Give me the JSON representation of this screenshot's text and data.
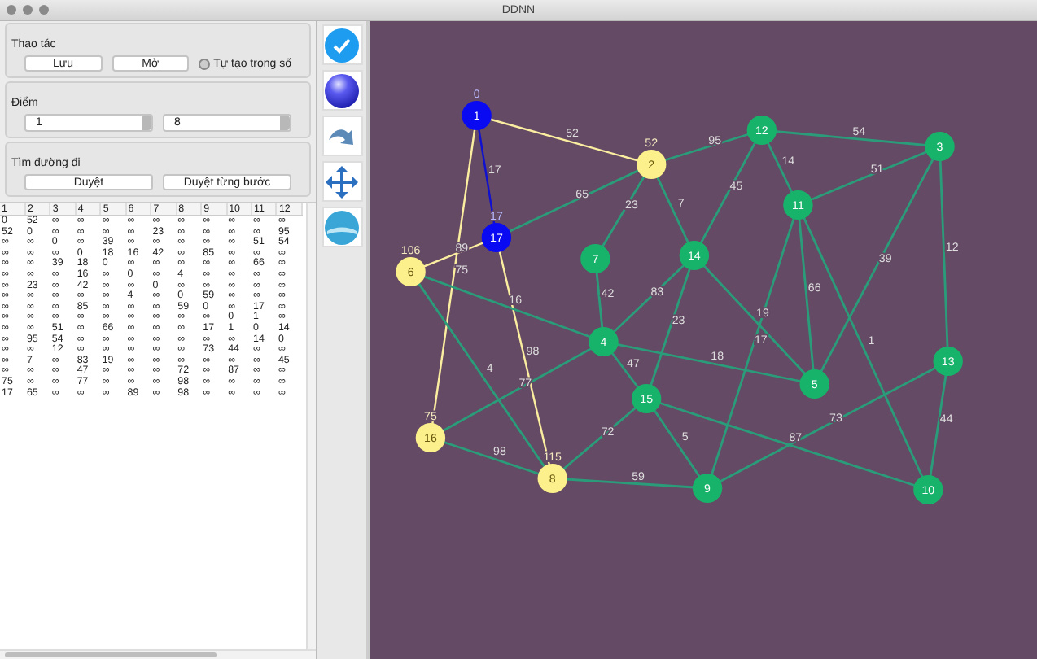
{
  "window": {
    "title": "DDNN"
  },
  "operations": {
    "title": "Thao tác",
    "buttons": [
      "Lưu",
      "Mở"
    ],
    "radio": {
      "label": "Tự tạo trọng số",
      "checked": false
    }
  },
  "points": {
    "title": "Điểm",
    "from": "1",
    "to": "8"
  },
  "search": {
    "title": "Tìm đường đi",
    "buttons": [
      "Duyệt",
      "Duyệt từng bước"
    ]
  },
  "matrix": {
    "columns": [
      "1",
      "2",
      "3",
      "4",
      "5",
      "6",
      "7",
      "8",
      "9",
      "10",
      "11",
      "12"
    ],
    "rows": [
      [
        "0",
        "52",
        "∞",
        "∞",
        "∞",
        "∞",
        "∞",
        "∞",
        "∞",
        "∞",
        "∞",
        "∞"
      ],
      [
        "52",
        "0",
        "∞",
        "∞",
        "∞",
        "∞",
        "23",
        "∞",
        "∞",
        "∞",
        "∞",
        "95"
      ],
      [
        "∞",
        "∞",
        "0",
        "∞",
        "39",
        "∞",
        "∞",
        "∞",
        "∞",
        "∞",
        "51",
        "54"
      ],
      [
        "∞",
        "∞",
        "∞",
        "0",
        "18",
        "16",
        "42",
        "∞",
        "85",
        "∞",
        "∞",
        "∞"
      ],
      [
        "∞",
        "∞",
        "39",
        "18",
        "0",
        "∞",
        "∞",
        "∞",
        "∞",
        "∞",
        "66",
        "∞"
      ],
      [
        "∞",
        "∞",
        "∞",
        "16",
        "∞",
        "0",
        "∞",
        "4",
        "∞",
        "∞",
        "∞",
        "∞"
      ],
      [
        "∞",
        "23",
        "∞",
        "42",
        "∞",
        "∞",
        "0",
        "∞",
        "∞",
        "∞",
        "∞",
        "∞"
      ],
      [
        "∞",
        "∞",
        "∞",
        "∞",
        "∞",
        "4",
        "∞",
        "0",
        "59",
        "∞",
        "∞",
        "∞"
      ],
      [
        "∞",
        "∞",
        "∞",
        "85",
        "∞",
        "∞",
        "∞",
        "59",
        "0",
        "∞",
        "17",
        "∞"
      ],
      [
        "∞",
        "∞",
        "∞",
        "∞",
        "∞",
        "∞",
        "∞",
        "∞",
        "∞",
        "0",
        "1",
        "∞"
      ],
      [
        "∞",
        "∞",
        "51",
        "∞",
        "66",
        "∞",
        "∞",
        "∞",
        "17",
        "1",
        "0",
        "14"
      ],
      [
        "∞",
        "95",
        "54",
        "∞",
        "∞",
        "∞",
        "∞",
        "∞",
        "∞",
        "∞",
        "14",
        "0"
      ],
      [
        "∞",
        "∞",
        "12",
        "∞",
        "∞",
        "∞",
        "∞",
        "∞",
        "73",
        "44",
        "∞",
        "∞"
      ],
      [
        "∞",
        "7",
        "∞",
        "83",
        "19",
        "∞",
        "∞",
        "∞",
        "∞",
        "∞",
        "∞",
        "45"
      ],
      [
        "∞",
        "∞",
        "∞",
        "47",
        "∞",
        "∞",
        "∞",
        "72",
        "∞",
        "87",
        "∞",
        "∞"
      ],
      [
        "75",
        "∞",
        "∞",
        "77",
        "∞",
        "∞",
        "∞",
        "98",
        "∞",
        "∞",
        "∞",
        "∞"
      ],
      [
        "17",
        "65",
        "∞",
        "∞",
        "∞",
        "89",
        "∞",
        "98",
        "∞",
        "∞",
        "∞",
        "∞"
      ]
    ]
  },
  "graph": {
    "nodes": [
      {
        "label": "1",
        "kind": "path",
        "distance": "0"
      },
      {
        "label": "2",
        "kind": "visited",
        "distance": "52"
      },
      {
        "label": "3",
        "kind": "normal"
      },
      {
        "label": "4",
        "kind": "normal"
      },
      {
        "label": "5",
        "kind": "normal"
      },
      {
        "label": "6",
        "kind": "visited",
        "distance": "106"
      },
      {
        "label": "7",
        "kind": "normal"
      },
      {
        "label": "8",
        "kind": "visited",
        "distance": "115"
      },
      {
        "label": "9",
        "kind": "normal"
      },
      {
        "label": "10",
        "kind": "normal"
      },
      {
        "label": "11",
        "kind": "normal"
      },
      {
        "label": "12",
        "kind": "normal"
      },
      {
        "label": "13",
        "kind": "normal"
      },
      {
        "label": "14",
        "kind": "normal"
      },
      {
        "label": "15",
        "kind": "normal"
      },
      {
        "label": "16",
        "kind": "visited",
        "distance": "75"
      },
      {
        "label": "17",
        "kind": "path",
        "distance": "17"
      }
    ],
    "edges": [
      {
        "weight": "52",
        "kind": "visited"
      },
      {
        "weight": "17",
        "kind": "path"
      },
      {
        "weight": "75",
        "kind": "visited"
      },
      {
        "weight": "89",
        "kind": "visited"
      },
      {
        "weight": "98",
        "kind": "visited"
      },
      {
        "weight": "65",
        "kind": "normal"
      },
      {
        "weight": "23",
        "kind": "normal"
      },
      {
        "weight": "7",
        "kind": "normal"
      },
      {
        "weight": "95",
        "kind": "normal"
      },
      {
        "weight": "54",
        "kind": "normal"
      },
      {
        "weight": "45",
        "kind": "normal"
      },
      {
        "weight": "14",
        "kind": "normal"
      },
      {
        "weight": "51",
        "kind": "normal"
      },
      {
        "weight": "39",
        "kind": "normal"
      },
      {
        "weight": "12",
        "kind": "normal"
      },
      {
        "weight": "66",
        "kind": "normal"
      },
      {
        "weight": "1",
        "kind": "normal"
      },
      {
        "weight": "17",
        "kind": "normal"
      },
      {
        "weight": "19",
        "kind": "normal"
      },
      {
        "weight": "83",
        "kind": "normal"
      },
      {
        "weight": "23",
        "kind": "normal"
      },
      {
        "weight": "42",
        "kind": "normal"
      },
      {
        "weight": "16",
        "kind": "normal"
      },
      {
        "weight": "4",
        "kind": "normal"
      },
      {
        "weight": "18",
        "kind": "normal"
      },
      {
        "weight": "47",
        "kind": "normal"
      },
      {
        "weight": "77",
        "kind": "normal"
      },
      {
        "weight": "98",
        "kind": "normal"
      },
      {
        "weight": "72",
        "kind": "normal"
      },
      {
        "weight": "5",
        "kind": "normal"
      },
      {
        "weight": "87",
        "kind": "normal"
      },
      {
        "weight": "59",
        "kind": "normal"
      },
      {
        "weight": "73",
        "kind": "normal"
      },
      {
        "weight": "44",
        "kind": "normal"
      }
    ]
  }
}
